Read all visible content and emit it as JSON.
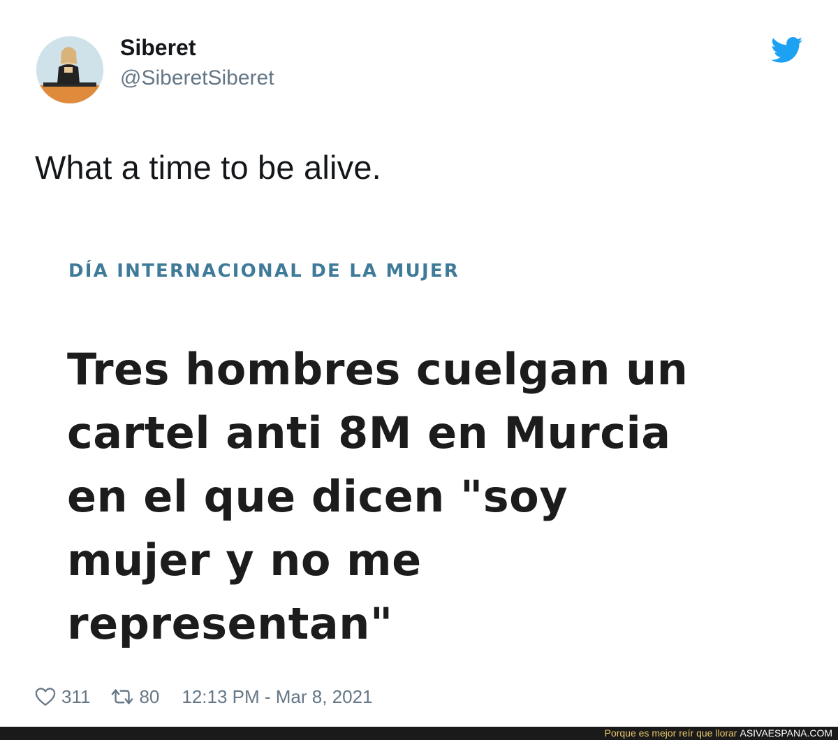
{
  "author": {
    "display_name": "Siberet",
    "handle": "@SiberetSiberet",
    "avatar_icon": "avatar-photo"
  },
  "brand": {
    "icon": "twitter-bird-icon",
    "color": "#1da1f2"
  },
  "tweet": {
    "text": "What a time to be alive."
  },
  "media": {
    "kicker": "DÍA INTERNACIONAL DE LA MUJER",
    "headline_lines": [
      "Tres hombres cuelgan un",
      "cartel anti 8M en Murcia",
      "en el que dicen \"soy",
      "mujer y no me",
      "representan\""
    ],
    "kicker_color": "#3f7b98"
  },
  "footer": {
    "likes": "311",
    "retweets": "80",
    "timestamp": "12:13 PM - Mar 8, 2021"
  },
  "watermark": {
    "tagline": "Porque es mejor reír que llorar",
    "site": "ASIVAESPANA.COM"
  }
}
